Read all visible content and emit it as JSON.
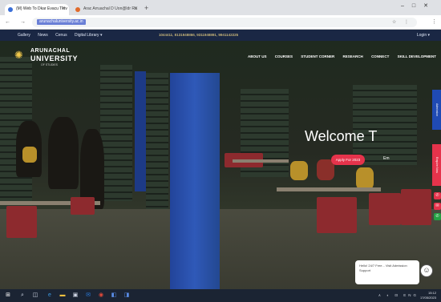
{
  "browser": {
    "tabs": [
      {
        "title": "(M) Web To Dkar Evacu Tkrv",
        "favicon_color": "#3a6fd8"
      },
      {
        "title": "Arac Arruachal D Uon@ldr Ru",
        "favicon_color": "#e06a2a"
      }
    ],
    "url": "arunachaluniversity.ac.in",
    "nav_glyphs": "← → ⟳",
    "omni_glyphs": "☆ ⋮"
  },
  "topbar": {
    "links": [
      "Gallery",
      "News",
      "Cenus",
      "Digital Library ▾"
    ],
    "phones": "1044411, 8131948866, 9311948891, 9941142225",
    "login": "Login ▾"
  },
  "logo": {
    "line1": "ARUNACHAL",
    "line2": "UNIVERSITY",
    "line3": "OF STUDIES"
  },
  "mainnav": {
    "items": [
      "ABOUT US",
      "COURSES",
      "STUDENT CORNER",
      "RESEARCH",
      "CONNECT",
      "SKILL DEVELOPMENT"
    ]
  },
  "hero": {
    "welcome": "Welcome T",
    "apply_label": "Apply For 2023",
    "secondary_label": "Em"
  },
  "side": {
    "tab1": "Admission",
    "tab2": "Enquire Now",
    "icons": [
      {
        "name": "phone-icon",
        "glyph": "✆",
        "color": "#e5334b"
      },
      {
        "name": "mail-icon",
        "glyph": "✉",
        "color": "#e5334b"
      },
      {
        "name": "whatsapp-icon",
        "glyph": "✆",
        "color": "#25a244"
      }
    ]
  },
  "chat": {
    "message": "Hello! 24/7 Free... Visit Admission Support"
  },
  "taskbar": {
    "tray": "∧ ◐ ⊡ ENG",
    "time": "15:12",
    "date": "17/05/2023"
  },
  "colors": {
    "topbar": "#1a2744",
    "accent": "#e5334b",
    "pillar": "#2f59b8"
  }
}
